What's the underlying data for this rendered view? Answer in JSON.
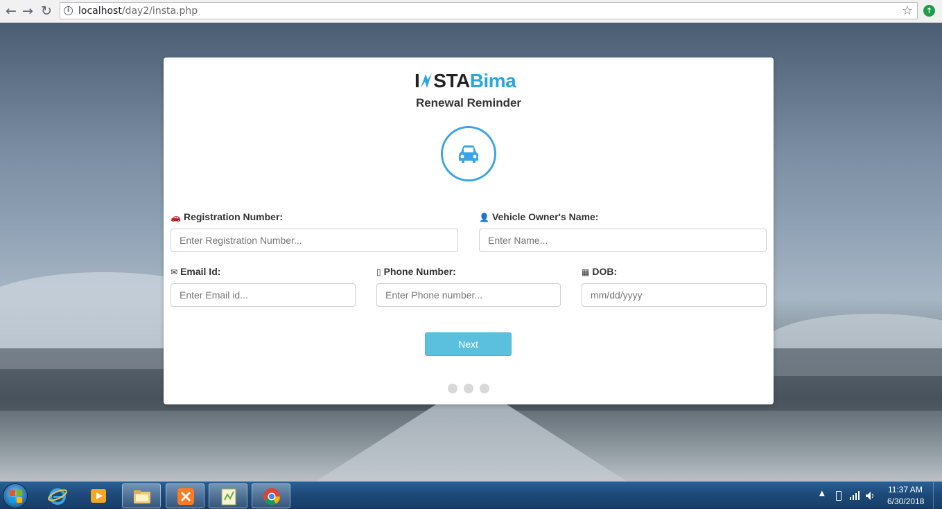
{
  "browser": {
    "url_host": "localhost",
    "url_path": "/day2/insta.php"
  },
  "card": {
    "logo_insta": "INSTA",
    "logo_bima": "Bima",
    "heading": "Renewal Reminder"
  },
  "form": {
    "registration": {
      "label": "Registration Number:",
      "placeholder": "Enter Registration Number..."
    },
    "owner": {
      "label": "Vehicle Owner's Name:",
      "placeholder": "Enter Name..."
    },
    "email": {
      "label": "Email Id:",
      "placeholder": "Enter Email id..."
    },
    "phone": {
      "label": "Phone Number:",
      "placeholder": "Enter Phone number..."
    },
    "dob": {
      "label": "DOB:",
      "placeholder": "mm/dd/yyyy"
    },
    "next_label": "Next"
  },
  "colors": {
    "accent": "#3aa4e6",
    "button": "#5bc0de",
    "logo_blue": "#2aa5df"
  },
  "taskbar": {
    "time": "11:37 AM",
    "date": "6/30/2018"
  }
}
